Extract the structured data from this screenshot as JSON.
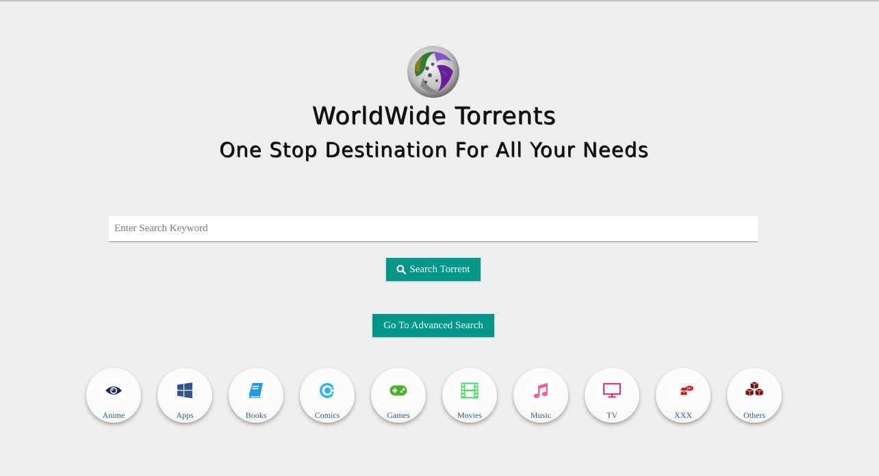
{
  "site": {
    "title": "WorldWide Torrents",
    "tagline": "One Stop Destination For All Your Needs",
    "logo_icon": "globe-swirl-logo"
  },
  "search": {
    "placeholder": "Enter Search Keyword",
    "value": "",
    "button_label": "Search Torrent",
    "button_icon": "search-icon",
    "advanced_label": "Go To Advanced Search"
  },
  "colors": {
    "accent": "#009688",
    "background": "#eeeeee",
    "category_label": "#2e5a86"
  },
  "categories": [
    {
      "label": "Anime",
      "icon": "eye-icon",
      "color": "#1b2a5c"
    },
    {
      "label": "Apps",
      "icon": "windows-icon",
      "color": "#2f5597"
    },
    {
      "label": "Books",
      "icon": "book-icon",
      "color": "#1e9be8"
    },
    {
      "label": "Comics",
      "icon": "comics-icon",
      "color": "#29b6f6"
    },
    {
      "label": "Games",
      "icon": "gamepad-icon",
      "color": "#4caf2a"
    },
    {
      "label": "Movies",
      "icon": "film-icon",
      "color": "#3ddc5a"
    },
    {
      "label": "Music",
      "icon": "music-icon",
      "color": "#f06292"
    },
    {
      "label": "TV",
      "icon": "tv-icon",
      "color": "#e91e63"
    },
    {
      "label": "XXX",
      "icon": "adult-18-icon",
      "color": "#cc1010",
      "badge": "18+"
    },
    {
      "label": "Others",
      "icon": "cubes-icon",
      "color": "#7a0d0d"
    }
  ]
}
